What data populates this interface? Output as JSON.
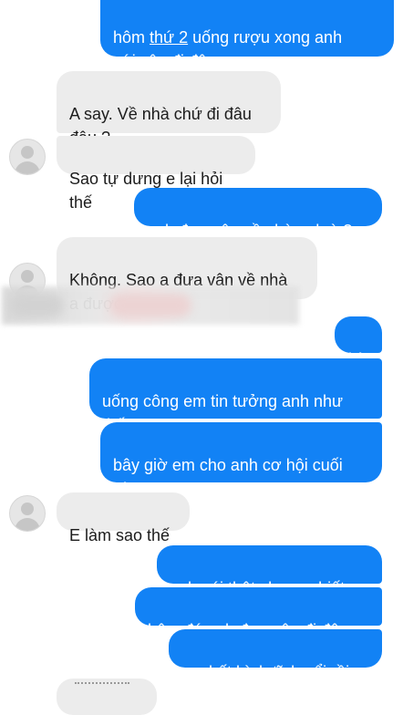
{
  "messages": {
    "m1": {
      "pre": "hôm ",
      "underlined": "thứ 2",
      "post": " uống rượu xong anh\nvới vân đi đâu"
    },
    "m2": "A say. Về nhà chứ đi đâu\nđâu.?",
    "m3": "Sao tự dưng e lại hỏi thế",
    "m4": "anh đưa vân về nhà anh à ?",
    "m5": "Không. Sao a đưa vân về nhà\na được.",
    "m6": "hừ",
    "m7": "uống công em tin tưởng anh như\nthế",
    "m8": "bây giờ em cho anh cơ hội cuối\ncùng",
    "m9": "E làm sao thế",
    "m10": "anh nói thật cho em biết",
    "m11": "hôm đó anh đưa vân đi đâu",
    "m12": "em hết bình tĩnh nổi rồi"
  },
  "colors": {
    "outgoing_bubble": "#1282f5",
    "incoming_bubble": "#ececec"
  },
  "icons": {
    "contact_avatar": "default-avatar-icon"
  }
}
